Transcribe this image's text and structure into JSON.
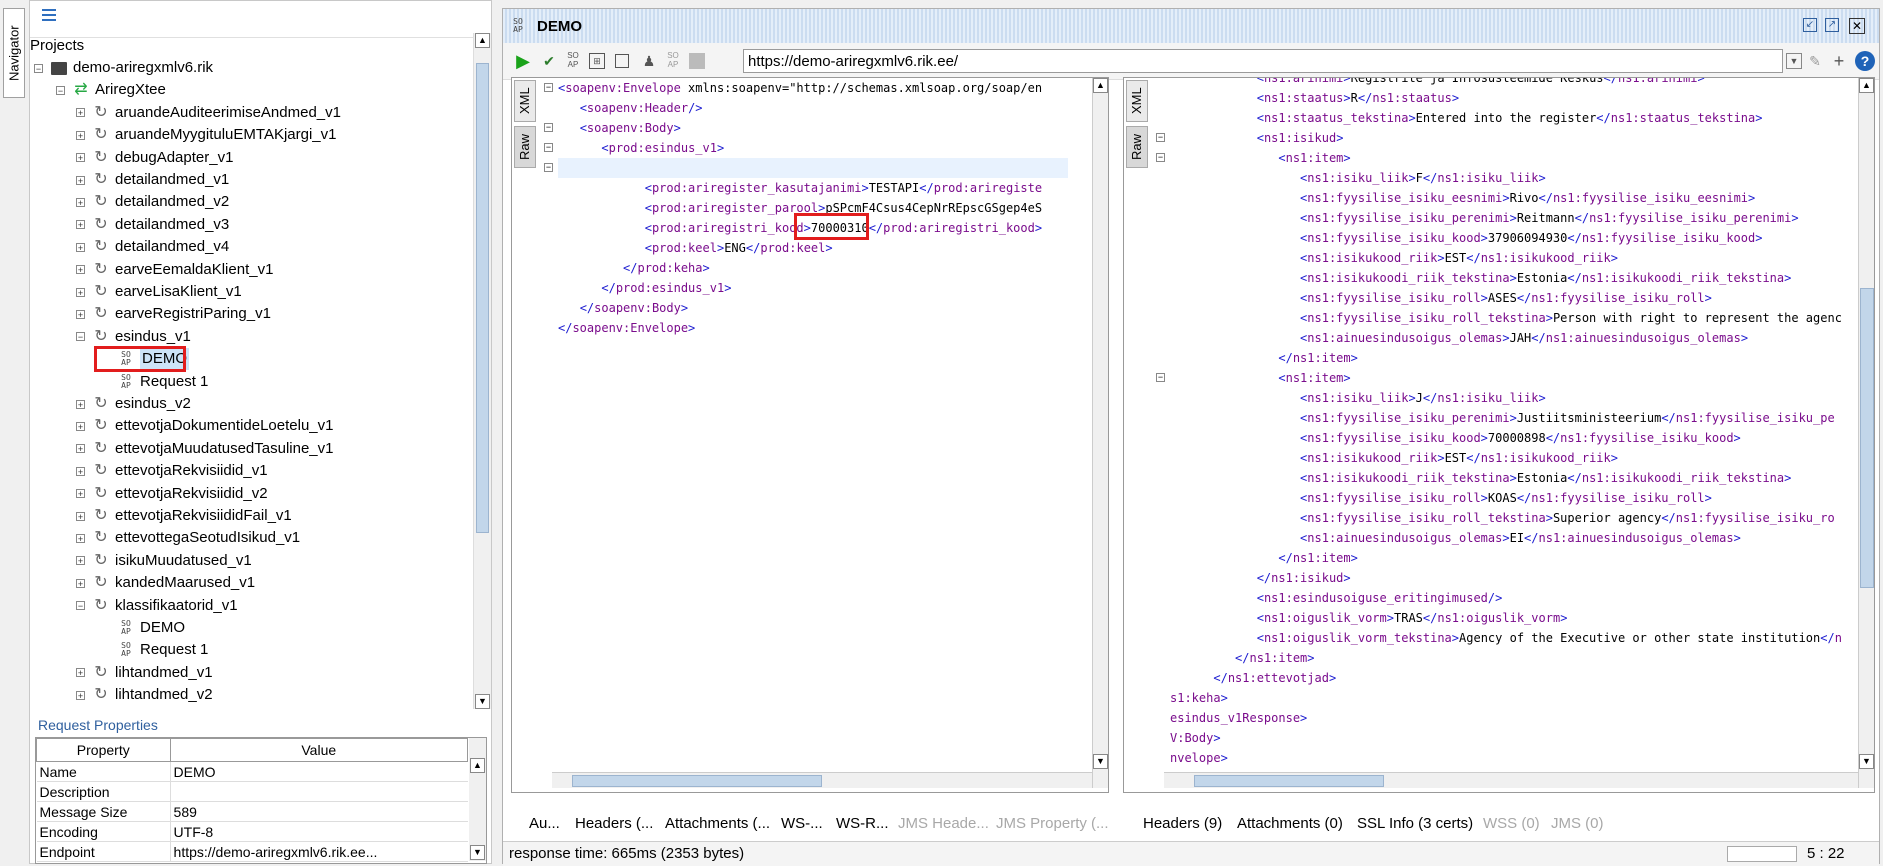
{
  "navigator": {
    "label": "Navigator"
  },
  "projects_label": "Projects",
  "tree": [
    {
      "label": "demo-ariregxmlv6.rik",
      "kind": "folder",
      "depth": 0,
      "exp": "−"
    },
    {
      "label": "AriregXtee",
      "kind": "arrows",
      "depth": 1,
      "exp": "−"
    },
    {
      "label": "aruandeAuditeerimiseAndmed_v1",
      "kind": "refresh",
      "depth": 2,
      "exp": "+"
    },
    {
      "label": "aruandeMyygituluEMTAKjargi_v1",
      "kind": "refresh",
      "depth": 2,
      "exp": "+"
    },
    {
      "label": "debugAdapter_v1",
      "kind": "refresh",
      "depth": 2,
      "exp": "+"
    },
    {
      "label": "detailandmed_v1",
      "kind": "refresh",
      "depth": 2,
      "exp": "+"
    },
    {
      "label": "detailandmed_v2",
      "kind": "refresh",
      "depth": 2,
      "exp": "+"
    },
    {
      "label": "detailandmed_v3",
      "kind": "refresh",
      "depth": 2,
      "exp": "+"
    },
    {
      "label": "detailandmed_v4",
      "kind": "refresh",
      "depth": 2,
      "exp": "+"
    },
    {
      "label": "earveEemaldaKlient_v1",
      "kind": "refresh",
      "depth": 2,
      "exp": "+"
    },
    {
      "label": "earveLisaKlient_v1",
      "kind": "refresh",
      "depth": 2,
      "exp": "+"
    },
    {
      "label": "earveRegistriParing_v1",
      "kind": "refresh",
      "depth": 2,
      "exp": "+"
    },
    {
      "label": "esindus_v1",
      "kind": "refresh",
      "depth": 2,
      "exp": "−"
    },
    {
      "label": "DEMO",
      "kind": "soap",
      "depth": 3,
      "exp": "",
      "selected": true
    },
    {
      "label": "Request 1",
      "kind": "soap",
      "depth": 3,
      "exp": ""
    },
    {
      "label": "esindus_v2",
      "kind": "refresh",
      "depth": 2,
      "exp": "+"
    },
    {
      "label": "ettevotjaDokumentideLoetelu_v1",
      "kind": "refresh",
      "depth": 2,
      "exp": "+"
    },
    {
      "label": "ettevotjaMuudatusedTasuline_v1",
      "kind": "refresh",
      "depth": 2,
      "exp": "+"
    },
    {
      "label": "ettevotjaRekvisiidid_v1",
      "kind": "refresh",
      "depth": 2,
      "exp": "+"
    },
    {
      "label": "ettevotjaRekvisiidid_v2",
      "kind": "refresh",
      "depth": 2,
      "exp": "+"
    },
    {
      "label": "ettevotjaRekvisiididFail_v1",
      "kind": "refresh",
      "depth": 2,
      "exp": "+"
    },
    {
      "label": "ettevottegaSeotudIsikud_v1",
      "kind": "refresh",
      "depth": 2,
      "exp": "+"
    },
    {
      "label": "isikuMuudatused_v1",
      "kind": "refresh",
      "depth": 2,
      "exp": "+"
    },
    {
      "label": "kandedMaarused_v1",
      "kind": "refresh",
      "depth": 2,
      "exp": "+"
    },
    {
      "label": "klassifikaatorid_v1",
      "kind": "refresh",
      "depth": 2,
      "exp": "−"
    },
    {
      "label": "DEMO",
      "kind": "soap",
      "depth": 3,
      "exp": ""
    },
    {
      "label": "Request 1",
      "kind": "soap",
      "depth": 3,
      "exp": ""
    },
    {
      "label": "lihtandmed_v1",
      "kind": "refresh",
      "depth": 2,
      "exp": "+"
    },
    {
      "label": "lihtandmed_v2",
      "kind": "refresh",
      "depth": 2,
      "exp": "+"
    }
  ],
  "request_properties": {
    "title": "Request Properties",
    "headers": [
      "Property",
      "Value"
    ],
    "rows": [
      [
        "Name",
        "DEMO"
      ],
      [
        "Description",
        ""
      ],
      [
        "Message Size",
        "589"
      ],
      [
        "Encoding",
        "UTF-8"
      ],
      [
        "Endpoint",
        "https://demo-ariregxmlv6.rik.ee..."
      ]
    ]
  },
  "editor": {
    "title": "DEMO",
    "soap_icon": "SO AP",
    "url": "https://demo-ariregxmlv6.rik.ee/",
    "tab_xml": "XML",
    "tab_raw": "Raw",
    "request_lines": [
      "<soapenv:Envelope xmlns:soapenv=\"http://schemas.xmlsoap.org/soap/en",
      "   <soapenv:Header/>",
      "   <soapenv:Body>",
      "      <prod:esindus_v1>",
      "         <prod:keha>",
      "            <prod:ariregister_kasutajanimi>TESTAPI</prod:ariregiste",
      "            <prod:ariregister_parool>pSPcmF4Csus4CepNrREpscGSgep4eS",
      "            <prod:ariregistri_kood>70000310</prod:ariregistri_kood>",
      "            <prod:keel>ENG</prod:keel>",
      "         </prod:keha>",
      "      </prod:esindus_v1>",
      "   </soapenv:Body>",
      "</soapenv:Envelope>"
    ],
    "response_lines": [
      "            <ns1:arinimi>Registrite ja Infosüsteemide Keskus</ns1:arinimi>",
      "            <ns1:staatus>R</ns1:staatus>",
      "            <ns1:staatus_tekstina>Entered into the register</ns1:staatus_tekstina>",
      "            <ns1:isikud>",
      "               <ns1:item>",
      "                  <ns1:isiku_liik>F</ns1:isiku_liik>",
      "                  <ns1:fyysilise_isiku_eesnimi>Rivo</ns1:fyysilise_isiku_eesnimi>",
      "                  <ns1:fyysilise_isiku_perenimi>Reitmann</ns1:fyysilise_isiku_perenimi>",
      "                  <ns1:fyysilise_isiku_kood>37906094930</ns1:fyysilise_isiku_kood>",
      "                  <ns1:isikukood_riik>EST</ns1:isikukood_riik>",
      "                  <ns1:isikukoodi_riik_tekstina>Estonia</ns1:isikukoodi_riik_tekstina>",
      "                  <ns1:fyysilise_isiku_roll>ASES</ns1:fyysilise_isiku_roll>",
      "                  <ns1:fyysilise_isiku_roll_tekstina>Person with right to represent the agenc",
      "                  <ns1:ainuesindusoigus_olemas>JAH</ns1:ainuesindusoigus_olemas>",
      "               </ns1:item>",
      "               <ns1:item>",
      "                  <ns1:isiku_liik>J</ns1:isiku_liik>",
      "                  <ns1:fyysilise_isiku_perenimi>Justiitsministeerium</ns1:fyysilise_isiku_pe",
      "                  <ns1:fyysilise_isiku_kood>70000898</ns1:fyysilise_isiku_kood>",
      "                  <ns1:isikukood_riik>EST</ns1:isikukood_riik>",
      "                  <ns1:isikukoodi_riik_tekstina>Estonia</ns1:isikukoodi_riik_tekstina>",
      "                  <ns1:fyysilise_isiku_roll>KOAS</ns1:fyysilise_isiku_roll>",
      "                  <ns1:fyysilise_isiku_roll_tekstina>Superior agency</ns1:fyysilise_isiku_ro",
      "                  <ns1:ainuesindusoigus_olemas>EI</ns1:ainuesindusoigus_olemas>",
      "               </ns1:item>",
      "            </ns1:isikud>",
      "            <ns1:esindusoiguse_eritingimused/>",
      "            <ns1:oiguslik_vorm>TRAS</ns1:oiguslik_vorm>",
      "            <ns1:oiguslik_vorm_tekstina>Agency of the Executive or other state institution</n",
      "         </ns1:item>",
      "      </ns1:ettevotjad>",
      "s1:keha>",
      "esindus_v1Response>",
      "V:Body>",
      "nvelope>"
    ],
    "request_tabs": [
      "Au...",
      "Headers (...",
      "Attachments (...",
      "WS-...",
      "WS-R...",
      "JMS Heade...",
      "JMS Property (..."
    ],
    "response_tabs": [
      "Headers (9)",
      "Attachments (0)",
      "SSL Info (3 certs)",
      "WSS (0)",
      "JMS (0)"
    ],
    "response_time": "response time: 665ms (2353 bytes)",
    "cursor_pos": "5 : 22"
  },
  "colors": {
    "tag": "#7a0c8c",
    "bracket": "#1c1cd0",
    "highlight": "#e21d1d",
    "selection": "#cde3f7"
  }
}
